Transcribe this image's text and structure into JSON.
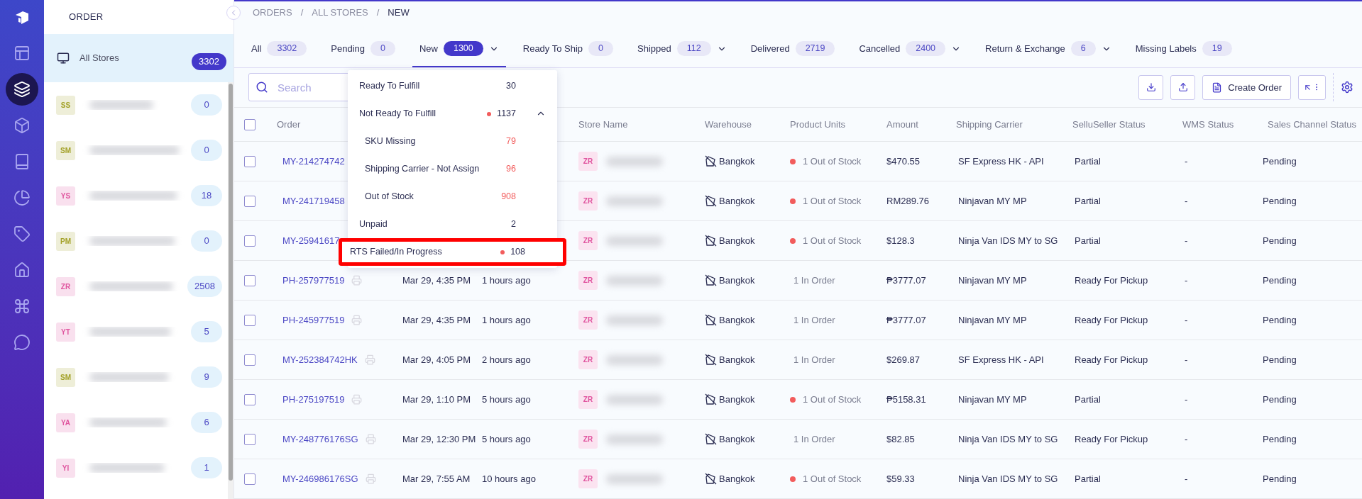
{
  "nav_rail": [
    {
      "selected": false
    },
    {
      "selected": true
    },
    {
      "selected": false
    },
    {
      "selected": false
    },
    {
      "selected": false
    },
    {
      "selected": false
    },
    {
      "selected": false
    },
    {
      "selected": false
    },
    {
      "selected": false
    }
  ],
  "store_panel": {
    "title": "ORDER",
    "all_stores": {
      "label": "All Stores",
      "count": "3302",
      "selected": true
    },
    "stores": [
      {
        "initials": "SS",
        "color": "#a3a128",
        "count": "0",
        "selected": false
      },
      {
        "initials": "SM",
        "color": "#a3a128",
        "count": "0",
        "selected": false
      },
      {
        "initials": "YS",
        "color": "#e0559f",
        "count": "18",
        "selected": false
      },
      {
        "initials": "PM",
        "color": "#a3a128",
        "count": "0",
        "selected": false
      },
      {
        "initials": "ZR",
        "color": "#e0559f",
        "count": "2508",
        "selected": false
      },
      {
        "initials": "YT",
        "color": "#e0559f",
        "count": "5",
        "selected": false
      },
      {
        "initials": "SM",
        "color": "#a3a128",
        "count": "9",
        "selected": false
      },
      {
        "initials": "YA",
        "color": "#e0559f",
        "count": "6",
        "selected": false
      },
      {
        "initials": "YI",
        "color": "#e0559f",
        "count": "1",
        "selected": false
      }
    ]
  },
  "breadcrumb": [
    "ORDERS",
    "/",
    "ALL STORES",
    "/",
    "NEW"
  ],
  "tabs": [
    {
      "label": "All",
      "count": "3302",
      "selected": false,
      "has_menu": false
    },
    {
      "label": "Pending",
      "count": "0",
      "selected": false,
      "has_menu": false
    },
    {
      "label": "New",
      "count": "1300",
      "selected": true,
      "has_menu": true
    },
    {
      "label": "Ready To Ship",
      "count": "0",
      "selected": false,
      "has_menu": false
    },
    {
      "label": "Shipped",
      "count": "112",
      "selected": false,
      "has_menu": true
    },
    {
      "label": "Delivered",
      "count": "2719",
      "selected": false,
      "has_menu": false
    },
    {
      "label": "Cancelled",
      "count": "2400",
      "selected": false,
      "has_menu": true
    },
    {
      "label": "Return & Exchange",
      "count": "6",
      "selected": false,
      "has_menu": true
    },
    {
      "label": "Missing Labels",
      "count": "19",
      "selected": false,
      "has_menu": false
    }
  ],
  "toolbar": {
    "search": {
      "placeholder": "Search"
    },
    "create_button": "Create Order"
  },
  "status_menu": {
    "items": [
      {
        "label": "Ready To Fulfill",
        "count": "30",
        "alert": false,
        "highlighted": false
      },
      {
        "label": "Not Ready To Fulfill",
        "count": "1137",
        "alert": true,
        "highlighted": false,
        "expanded": true,
        "children": [
          {
            "label": "SKU Missing",
            "count": "79"
          },
          {
            "label": "Shipping Carrier - Not Assign",
            "count": "96"
          },
          {
            "label": "Out of Stock",
            "count": "908"
          }
        ]
      },
      {
        "label": "Unpaid",
        "count": "2",
        "alert": false,
        "highlighted": false
      },
      {
        "label": "RTS Failed/In Progress",
        "count": "108",
        "alert": true,
        "highlighted": true
      }
    ]
  },
  "table": {
    "all_checked": false,
    "columns": [
      "Order",
      "Store Name",
      "Warehouse",
      "Product Units",
      "Amount",
      "Shipping Carrier",
      "SelluSeller Status",
      "WMS Status",
      "Sales Channel Status"
    ],
    "rows": [
      {
        "checked": false,
        "order": "MY-214274742",
        "printer": false,
        "store": "ZR",
        "warehouse": "Bangkok",
        "units": "1 Out of Stock",
        "units_alert": true,
        "amount": "$470.55",
        "carrier": "SF Express HK - API",
        "seller_status": "Partial",
        "wms_status": "-",
        "channel_status": "Pending"
      },
      {
        "checked": false,
        "order": "MY-241719458",
        "printer": false,
        "store": "ZR",
        "warehouse": "Bangkok",
        "units": "1 Out of Stock",
        "units_alert": true,
        "amount": "RM289.76",
        "carrier": "Ninjavan MY MP",
        "seller_status": "Partial",
        "wms_status": "-",
        "channel_status": "Pending"
      },
      {
        "checked": false,
        "order": "MY-25941617",
        "printer": false,
        "store": "ZR",
        "warehouse": "Bangkok",
        "units": "1 Out of Stock",
        "units_alert": true,
        "amount": "$128.3",
        "carrier": "Ninja Van IDS MY to SG",
        "seller_status": "Partial",
        "wms_status": "-",
        "channel_status": "Pending"
      },
      {
        "checked": false,
        "order": "PH-257977519",
        "printer": true,
        "date": "Mar 29, 4:35 PM",
        "ago": "1 hours ago",
        "store": "ZR",
        "warehouse": "Bangkok",
        "units": "1 In Order",
        "units_alert": false,
        "amount": "₱3777.07",
        "carrier": "Ninjavan MY MP",
        "seller_status": "Ready For Pickup",
        "wms_status": "-",
        "channel_status": "Pending"
      },
      {
        "checked": false,
        "order": "PH-245977519",
        "printer": true,
        "date": "Mar 29, 4:35 PM",
        "ago": "1 hours ago",
        "store": "ZR",
        "warehouse": "Bangkok",
        "units": "1 In Order",
        "units_alert": false,
        "amount": "₱3777.07",
        "carrier": "Ninjavan MY MP",
        "seller_status": "Ready For Pickup",
        "wms_status": "-",
        "channel_status": "Pending"
      },
      {
        "checked": false,
        "order": "MY-252384742HK",
        "printer": true,
        "date": "Mar 29, 4:05 PM",
        "ago": "2 hours ago",
        "store": "ZR",
        "warehouse": "Bangkok",
        "units": "1 In Order",
        "units_alert": false,
        "amount": "$269.87",
        "carrier": "SF Express HK - API",
        "seller_status": "Ready For Pickup",
        "wms_status": "-",
        "channel_status": "Pending"
      },
      {
        "checked": false,
        "order": "PH-275197519",
        "printer": true,
        "date": "Mar 29, 1:10 PM",
        "ago": "5 hours ago",
        "store": "ZR",
        "warehouse": "Bangkok",
        "units": "1 Out of Stock",
        "units_alert": true,
        "amount": "₱5158.31",
        "carrier": "Ninjavan MY MP",
        "seller_status": "Partial",
        "wms_status": "-",
        "channel_status": "Pending"
      },
      {
        "checked": false,
        "order": "MY-248776176SG",
        "printer": true,
        "date": "Mar 29, 12:30 PM",
        "ago": "5 hours ago",
        "store": "ZR",
        "warehouse": "Bangkok",
        "units": "1 In Order",
        "units_alert": false,
        "amount": "$82.85",
        "carrier": "Ninja Van IDS MY to SG",
        "seller_status": "Ready For Pickup",
        "wms_status": "-",
        "channel_status": "Pending"
      },
      {
        "checked": false,
        "order": "MY-246986176SG",
        "printer": true,
        "date": "Mar 29, 7:55 AM",
        "ago": "10 hours ago",
        "store": "ZR",
        "warehouse": "Bangkok",
        "units": "1 Out of Stock",
        "units_alert": true,
        "amount": "$59.33",
        "carrier": "Ninja Van IDS MY to SG",
        "seller_status": "Partial",
        "wms_status": "-",
        "channel_status": "Pending"
      }
    ]
  }
}
